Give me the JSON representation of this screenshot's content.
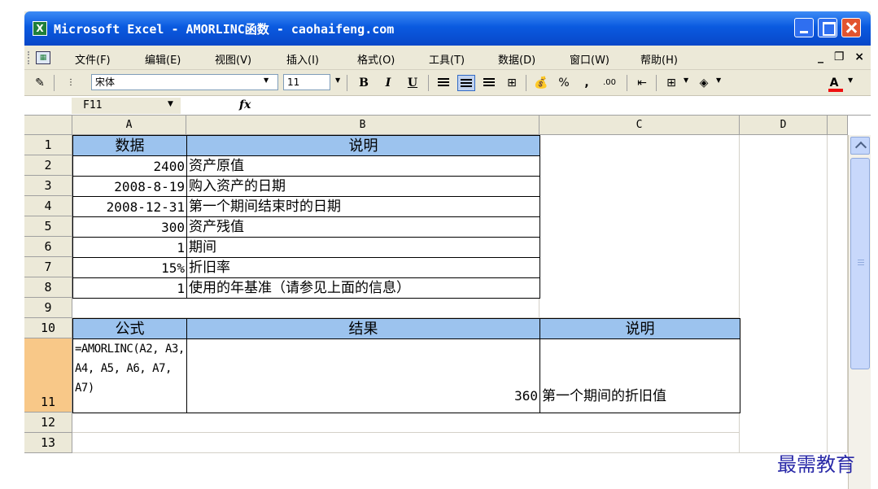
{
  "window": {
    "title": "Microsoft Excel - AMORLINC函数 - caohaifeng.com"
  },
  "menubar": {
    "items": [
      "文件(F)",
      "编辑(E)",
      "视图(V)",
      "插入(I)",
      "格式(O)",
      "工具(T)",
      "数据(D)",
      "窗口(W)",
      "帮助(H)"
    ],
    "controls": "_ ❐ ×"
  },
  "toolbar": {
    "font_name": "宋体",
    "font_size": "11",
    "bold": "B",
    "italic": "I",
    "underline": "U",
    "percent": "%",
    "comma": ",",
    "decimals": ".00",
    "font_color_letter": "A"
  },
  "formula_bar": {
    "name_box": "F11",
    "fx": "fx",
    "content": ""
  },
  "sheet": {
    "columns": [
      "A",
      "B",
      "C",
      "D"
    ],
    "rows": [
      "1",
      "2",
      "3",
      "4",
      "5",
      "6",
      "7",
      "8",
      "9",
      "10",
      "11",
      "12",
      "13"
    ],
    "cells": {
      "A1": "数据",
      "B1": "说明",
      "A2": "2400",
      "B2": "资产原值",
      "A3": "2008-8-19",
      "B3": "购入资产的日期",
      "A4": "2008-12-31",
      "B4": "第一个期间结束时的日期",
      "A5": "300",
      "B5": "资产残值",
      "A6": "1",
      "B6": "期间",
      "A7": "15%",
      "B7": "折旧率",
      "A8": "1",
      "B8": "使用的年基准（请参见上面的信息）",
      "A10": "公式",
      "B10": "结果",
      "C10": "说明",
      "A11": "=AMORLINC(A2, A3, A4, A5, A6, A7, A7)",
      "B11": "360",
      "C11": "第一个期间的折旧值"
    }
  },
  "watermark": "最需教育"
}
